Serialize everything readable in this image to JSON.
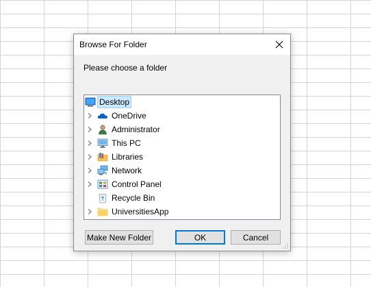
{
  "dialog": {
    "title": "Browse For Folder",
    "prompt": "Please choose a folder",
    "close_icon": "close-icon"
  },
  "tree": {
    "items": [
      {
        "label": "Desktop",
        "icon": "desktop-icon",
        "expandable": false,
        "selected": true,
        "level": 0
      },
      {
        "label": "OneDrive",
        "icon": "cloud-icon",
        "expandable": true,
        "selected": false,
        "level": 1
      },
      {
        "label": "Administrator",
        "icon": "user-icon",
        "expandable": true,
        "selected": false,
        "level": 1
      },
      {
        "label": "This PC",
        "icon": "computer-icon",
        "expandable": true,
        "selected": false,
        "level": 1
      },
      {
        "label": "Libraries",
        "icon": "libraries-icon",
        "expandable": true,
        "selected": false,
        "level": 1
      },
      {
        "label": "Network",
        "icon": "network-icon",
        "expandable": true,
        "selected": false,
        "level": 1
      },
      {
        "label": "Control Panel",
        "icon": "control-panel-icon",
        "expandable": true,
        "selected": false,
        "level": 1
      },
      {
        "label": "Recycle Bin",
        "icon": "recycle-bin-icon",
        "expandable": false,
        "selected": false,
        "level": 1
      },
      {
        "label": "UniversitiesApp",
        "icon": "folder-icon",
        "expandable": true,
        "selected": false,
        "level": 1
      }
    ]
  },
  "buttons": {
    "make_new_folder": "Make New Folder",
    "ok": "OK",
    "cancel": "Cancel"
  },
  "colors": {
    "selection_bg": "#cce8ff",
    "selection_border": "#99d1ff",
    "default_button_border": "#0078d7",
    "dialog_bg": "#f0f0f0"
  }
}
